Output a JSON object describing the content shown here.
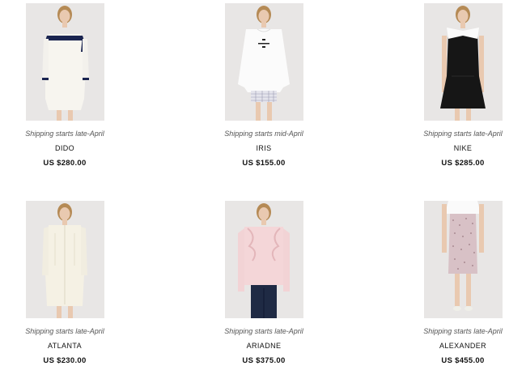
{
  "products": [
    {
      "name": "DIDO",
      "shipping": "Shipping starts late-April",
      "price": "US $280.00",
      "image_icon": "model-white-sailor-dress"
    },
    {
      "name": "IRIS",
      "shipping": "Shipping starts mid-April",
      "price": "US $155.00",
      "image_icon": "model-white-sweatshirt"
    },
    {
      "name": "NIKE",
      "shipping": "Shipping starts late-April",
      "price": "US $285.00",
      "image_icon": "model-black-dress-white-collar"
    },
    {
      "name": "ATLANTA",
      "shipping": "Shipping starts late-April",
      "price": "US $230.00",
      "image_icon": "model-cream-shirt-dress"
    },
    {
      "name": "ARIADNE",
      "shipping": "Shipping starts late-April",
      "price": "US $375.00",
      "image_icon": "model-pink-ruffle-blouse"
    },
    {
      "name": "ALEXANDER",
      "shipping": "Shipping starts late-April",
      "price": "US $455.00",
      "image_icon": "model-pencil-skirt"
    }
  ],
  "colors": {
    "photo_bg": "#e6e4e3",
    "text": "#111111",
    "shipping_text": "#555555"
  }
}
